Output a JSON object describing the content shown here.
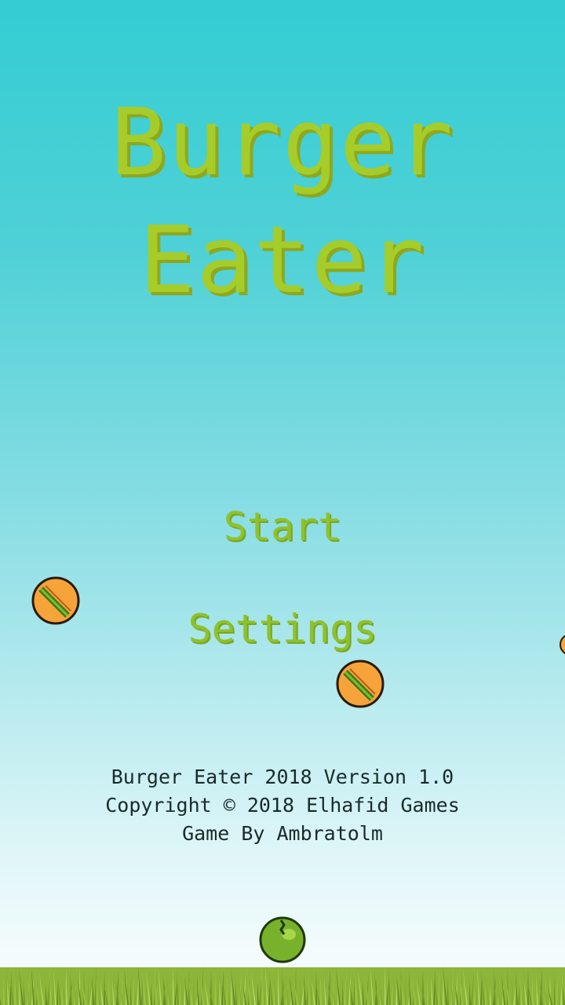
{
  "title": {
    "line1": "Burger",
    "line2": "Eater"
  },
  "menu": {
    "start_label": "Start",
    "settings_label": "Settings"
  },
  "credits": {
    "line1": "Burger Eater 2018 Version 1.0",
    "line2": "Copyright © 2018 Elhafid Games",
    "line3": "Game By Ambratolm"
  },
  "sprites": {
    "burgers": [
      "burger-icon",
      "burger-icon",
      "burger-icon"
    ],
    "ground_item": "green-apple-icon",
    "ground": "grass"
  },
  "colors": {
    "sky_top": "#33cdd3",
    "sky_bottom": "#f4fbfc",
    "title_green": "#a6cc2a",
    "menu_green": "#8fc12e",
    "burger_bun": "#f6a43a",
    "grass": "#8db53a"
  }
}
